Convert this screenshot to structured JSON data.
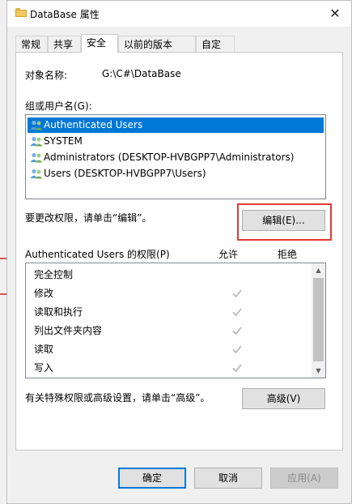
{
  "window": {
    "title": "DataBase 属性"
  },
  "tabs": [
    {
      "label": "常规",
      "active": false
    },
    {
      "label": "共享",
      "active": false
    },
    {
      "label": "安全",
      "active": true
    },
    {
      "label": "以前的版本",
      "active": false
    },
    {
      "label": "自定义",
      "active": false
    }
  ],
  "security": {
    "object_label": "对象名称:",
    "object_value": "G:\\C#\\DataBase",
    "group_label": "组或用户名(G):",
    "users": [
      "Authenticated Users",
      "SYSTEM",
      "Administrators (DESKTOP-HVBGPP7\\Administrators)",
      "Users (DESKTOP-HVBGPP7\\Users)"
    ],
    "edit_hint": "要更改权限，请单击“编辑”。",
    "edit_button": "编辑(E)...",
    "perm_header": "Authenticated Users 的权限(P)",
    "allow_header": "允许",
    "deny_header": "拒绝",
    "permissions": [
      {
        "name": "完全控制",
        "allow": false
      },
      {
        "name": "修改",
        "allow": true
      },
      {
        "name": "读取和执行",
        "allow": true
      },
      {
        "name": "列出文件夹内容",
        "allow": true
      },
      {
        "name": "读取",
        "allow": true
      },
      {
        "name": "写入",
        "allow": true
      }
    ],
    "advanced_hint": "有关特殊权限或高级设置，请单击“高级”。",
    "advanced_button": "高级(V)"
  },
  "footer": {
    "ok": "确定",
    "cancel": "取消",
    "apply": "应用(A)"
  },
  "colors": {
    "accent": "#0078d7",
    "highlight": "#e53935"
  }
}
